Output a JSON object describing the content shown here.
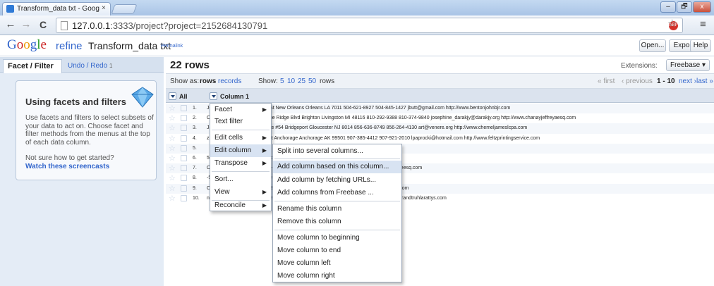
{
  "browser": {
    "tab_title": "Transform_data txt - Goog",
    "tab_close": "×",
    "url_host": "127.0.0.1",
    "url_rest": ":3333/project?project=2152684130791",
    "win_minimize": "–",
    "win_maximize": "🗗",
    "win_close": "x",
    "back": "←",
    "forward": "→",
    "reload": "C",
    "star": "☆",
    "menu": "≡",
    "abp": "ABP"
  },
  "header": {
    "logo_letters": [
      "G",
      "o",
      "o",
      "g",
      "l",
      "e"
    ],
    "logo_refine": "refine",
    "project_name": "Transform_data txt",
    "permalink": "Permalink",
    "open_btn": "Open...",
    "export_btn": "Export ▾",
    "help_btn": "Help"
  },
  "left": {
    "tab_facet": "Facet / Filter",
    "tab_undo": "Undo / Redo",
    "undo_count": "1",
    "help_title": "Using facets and filters",
    "help_body": "Use facets and filters to select subsets of your data to act on. Choose facet and filter methods from the menus at the top of each data column.",
    "help_question": "Not sure how to get started?",
    "help_link": "Watch these screencasts"
  },
  "data": {
    "row_count": "22 rows",
    "extensions_label": "Extensions:",
    "extensions_btn": "Freebase ▾",
    "show_as": "Show as:",
    "mode_rows": "rows",
    "mode_records": "records",
    "show": "Show:",
    "page_sizes": [
      "5",
      "10",
      "25",
      "50"
    ],
    "rows_suffix": "rows",
    "pager_first": "« first",
    "pager_prev": "‹ previous",
    "pager_range": "1 - 10",
    "pager_next": "next ›",
    "pager_last": "last »",
    "col_all": "All",
    "col_1": "Column 1",
    "rows": [
      {
        "n": "1.",
        "text": "John B Jr 6649 N Blue Gum St New Orleans Orleans LA 7011 504-621-8927 504-845-1427 jbutt@gmail.com http://www.bentonjohnbjr.com"
      },
      {
        "n": "2.",
        "text": "Chanay, Jeffrey A Esq 4 B Blue Ridge Blvd Brighton Livingston MI 48116 810-292-9388 810-374-9840 josephine_darakjy@darakjy.org http://www.chanayjeffreyaesq.com"
      },
      {
        "n": "3.",
        "text": "James L Cpa 8 W Cerritos Ave #54 Bridgeport Gloucester NJ 8014 856-636-8749 856-264-4130 art@venere.org http://www.chemeljameslcpa.com"
      },
      {
        "n": "4.",
        "text": "z Printing Service 639 Main St Anchorage Anchorage AK 99501 907-385-4412 907-921-2010 lpaprocki@hotmail.com http://www.feltzprintingservice.com"
      },
      {
        "n": "5.",
        "text": ""
      },
      {
        "n": "6.",
        "text": "513-570-1893 513-549-4561 donette.foller@cox.net http://www.printingdimensions.com"
      },
      {
        "n": "7.",
        "text": "OH 44805 419-503-2484 419-800-6759 simona@morasca.com http://www.chapmanrosseesq.com"
      },
      {
        "n": "8.",
        "text": "-573-6914 773-924-8565 mitsue_tollner@yahoo.com http://www.morlongassociates.com"
      },
      {
        "n": "9.",
        "text": "CA 95111 408-752-3500 408-813-1105 leota@hotmail.com http://www.commercialpress.com"
      },
      {
        "n": "10.",
        "text": "nnehaha SD 57105 605-414-2147 605-794-4895 sage_wieser@cox.net http://www.truhlarandtruhlarattys.com"
      }
    ]
  },
  "column_menu": {
    "items": [
      "Facet",
      "Text filter",
      "Edit cells",
      "Edit column",
      "Transpose",
      "Sort...",
      "View",
      "Reconcile"
    ]
  },
  "submenu": {
    "items": [
      "Split into several columns...",
      "Add column based on this column...",
      "Add column by fetching URLs...",
      "Add columns from Freebase ...",
      "Rename this column",
      "Remove this column",
      "Move column to beginning",
      "Move column to end",
      "Move column left",
      "Move column right"
    ]
  },
  "colors": {
    "accent": "#3366cc",
    "hover": "#d8e3f2",
    "panel": "#e4ecf6"
  }
}
